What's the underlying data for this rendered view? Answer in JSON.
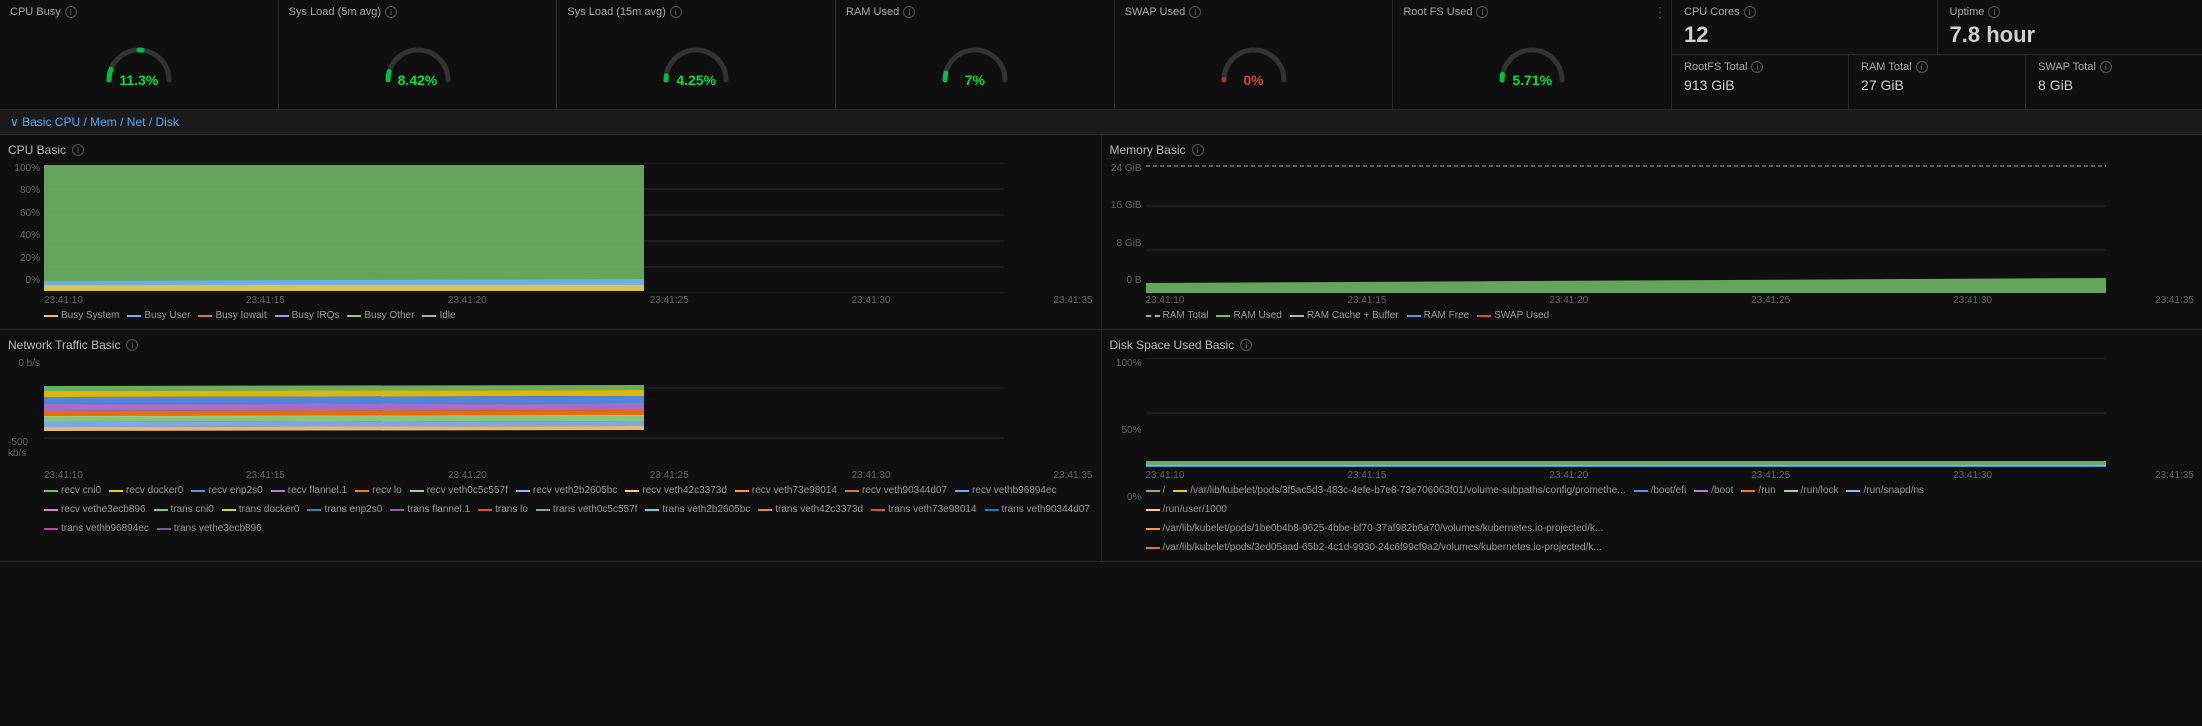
{
  "metrics": [
    {
      "id": "cpu-busy",
      "title": "CPU Busy",
      "value": "11.3%",
      "color": "green",
      "gaugePercent": 11.3
    },
    {
      "id": "sys-load-5m",
      "title": "Sys Load (5m avg)",
      "value": "8.42%",
      "color": "green",
      "gaugePercent": 8.42
    },
    {
      "id": "sys-load-15m",
      "title": "Sys Load (15m avg)",
      "value": "4.25%",
      "color": "green",
      "gaugePercent": 4.25
    },
    {
      "id": "ram-used",
      "title": "RAM Used",
      "value": "7%",
      "color": "green",
      "gaugePercent": 7
    },
    {
      "id": "swap-used",
      "title": "SWAP Used",
      "value": "0%",
      "color": "red",
      "gaugePercent": 0
    },
    {
      "id": "root-fs-used",
      "title": "Root FS Used",
      "value": "5.71%",
      "color": "green",
      "gaugePercent": 5.71
    }
  ],
  "right_panel": {
    "top": [
      {
        "label": "CPU Cores",
        "value": "12"
      },
      {
        "label": "Uptime",
        "value": "7.8 hour"
      }
    ],
    "bottom": [
      {
        "label": "RootFS Total",
        "value": "913 GiB"
      },
      {
        "label": "RAM Total",
        "value": "27 GiB"
      },
      {
        "label": "SWAP Total",
        "value": "8 GiB"
      }
    ]
  },
  "section_header": "Basic CPU / Mem / Net / Disk",
  "charts": {
    "cpu_basic": {
      "title": "CPU Basic",
      "yaxis": [
        "100%",
        "80%",
        "60%",
        "40%",
        "20%",
        "0%"
      ],
      "xaxis": [
        "23:41:10",
        "23:41:15",
        "23:41:20",
        "23:41:25",
        "23:41:30",
        "23:41:35"
      ],
      "legend": [
        {
          "label": "Busy System",
          "color": "#e6c84a",
          "type": "solid"
        },
        {
          "label": "Busy User",
          "color": "#6ab0f5",
          "type": "solid"
        },
        {
          "label": "Busy Iowait",
          "color": "#e07070",
          "type": "solid"
        },
        {
          "label": "Busy IRQs",
          "color": "#b090e0",
          "type": "solid"
        },
        {
          "label": "Busy Other",
          "color": "#90d090",
          "type": "solid"
        },
        {
          "label": "Idle",
          "color": "#aaaaaa",
          "type": "solid"
        }
      ]
    },
    "memory_basic": {
      "title": "Memory Basic",
      "yaxis": [
        "24 GiB",
        "16 GiB",
        "8 GiB",
        "0 B"
      ],
      "xaxis": [
        "23:41:10",
        "23:41:15",
        "23:41:20",
        "23:41:25",
        "23:41:30",
        "23:41:35"
      ],
      "legend": [
        {
          "label": "RAM Total",
          "color": "#aaaaaa",
          "type": "dashed"
        },
        {
          "label": "RAM Used",
          "color": "#73bf69",
          "type": "solid"
        },
        {
          "label": "RAM Cache + Buffer",
          "color": "#b5b5b5",
          "type": "solid"
        },
        {
          "label": "RAM Free",
          "color": "#5794f2",
          "type": "solid"
        },
        {
          "label": "SWAP Used",
          "color": "#e04848",
          "type": "solid"
        }
      ]
    },
    "network_traffic": {
      "title": "Network Traffic Basic",
      "yaxis": [
        "0 b/s",
        "-500 kb/s"
      ],
      "xaxis": [
        "23:41:10",
        "23:41:15",
        "23:41:20",
        "23:41:25",
        "23:41:30",
        "23:41:35"
      ],
      "legend": [
        {
          "label": "recv cni0",
          "color": "#73bf69"
        },
        {
          "label": "recv docker0",
          "color": "#f2cc0c"
        },
        {
          "label": "recv enp2s0",
          "color": "#5794f2"
        },
        {
          "label": "recv flannel.1",
          "color": "#b877d9"
        },
        {
          "label": "recv lo",
          "color": "#ff780a"
        },
        {
          "label": "recv veth0c5c557f",
          "color": "#96d98d"
        },
        {
          "label": "recv veth2b2605bc",
          "color": "#8ab8ff"
        },
        {
          "label": "recv veth42c3373d",
          "color": "#ffcb7d"
        },
        {
          "label": "recv veth73e98014",
          "color": "#ff9830"
        },
        {
          "label": "recv veth90344d07",
          "color": "#e0752d"
        },
        {
          "label": "recv vethb96894ec",
          "color": "#64b0eb"
        },
        {
          "label": "recv vethe3ecb896",
          "color": "#d683ce"
        },
        {
          "label": "trans cni0",
          "color": "#6ccf8e"
        },
        {
          "label": "trans docker0",
          "color": "#c4d93e"
        },
        {
          "label": "trans enp2s0",
          "color": "#447ebc"
        },
        {
          "label": "trans flannel.1",
          "color": "#9461ad"
        },
        {
          "label": "trans lo",
          "color": "#e24d42"
        },
        {
          "label": "trans veth0c5c557f",
          "color": "#7eb26d"
        },
        {
          "label": "trans veth2b2605bc",
          "color": "#6ed0e0"
        },
        {
          "label": "trans veth42c3373d",
          "color": "#ef843c"
        },
        {
          "label": "trans veth73e98014",
          "color": "#e24d42"
        },
        {
          "label": "trans veth90344d07",
          "color": "#1f78c1"
        },
        {
          "label": "trans vethb96894ec",
          "color": "#ba43a9"
        },
        {
          "label": "trans vethe3ecb896",
          "color": "#705da0"
        }
      ]
    },
    "disk_space": {
      "title": "Disk Space Used Basic",
      "yaxis": [
        "100%",
        "50%",
        "0%"
      ],
      "xaxis": [
        "23:41:10",
        "23:41:15",
        "23:41:20",
        "23:41:25",
        "23:41:30",
        "23:41:35"
      ],
      "legend": [
        {
          "label": "/",
          "color": "#73bf69"
        },
        {
          "label": "/var/lib/kubelet/pods/3f5ac5d3-483c-4efe-b7e8-73e706063f01/volume-subpaths/config/promethe...",
          "color": "#f2cc0c"
        },
        {
          "label": "/boot/efi",
          "color": "#5794f2"
        },
        {
          "label": "/boot",
          "color": "#b877d9"
        },
        {
          "label": "/run",
          "color": "#ff780a"
        },
        {
          "label": "/run/lock",
          "color": "#96d98d"
        },
        {
          "label": "/run/snapd/ns",
          "color": "#8ab8ff"
        },
        {
          "label": "/run/user/1000",
          "color": "#ffcb7d"
        },
        {
          "label": "/var/lib/kubelet/pods/1be0b4b8-9625-4bbe-bf70-37af982b6a70/volumes/kubernetes.io-projected/k...",
          "color": "#ff9830"
        },
        {
          "label": "/var/lib/kubelet/pods/3ed05aad-65b2-4c1d-9930-24c6f99cf9a2/volumes/kubernetes.io-projected/k...",
          "color": "#e0752d"
        }
      ]
    }
  },
  "icons": {
    "info": "ⓘ",
    "more": "⋮",
    "chevron_down": "∨"
  }
}
